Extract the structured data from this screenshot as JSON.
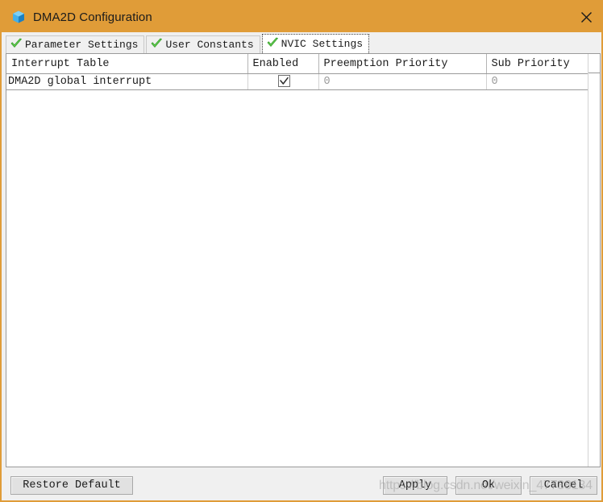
{
  "window": {
    "title": "DMA2D Configuration",
    "icon": "cube-icon",
    "close_label": "✕",
    "titlebar_color": "#e09c38",
    "border_color": "#e09c38",
    "panel_color": "#f0f0f0"
  },
  "tabs": [
    {
      "label": "Parameter Settings",
      "icon": "green-check-icon",
      "selected": false
    },
    {
      "label": "User Constants",
      "icon": "green-check-icon",
      "selected": false
    },
    {
      "label": "NVIC Settings",
      "icon": "green-check-icon",
      "selected": true
    }
  ],
  "table": {
    "columns": [
      "Interrupt Table",
      "Enabled",
      "Preemption Priority",
      "Sub Priority"
    ],
    "rows": [
      {
        "interrupt": "DMA2D global interrupt",
        "enabled": true,
        "preemption_priority": "0",
        "sub_priority": "0"
      }
    ]
  },
  "buttons": {
    "restore_default": "Restore Default",
    "apply": "Apply",
    "ok": "Ok",
    "cancel": "Cancel"
  },
  "watermark": {
    "text": "https://blog.csdn.net/weixin_47738134"
  }
}
